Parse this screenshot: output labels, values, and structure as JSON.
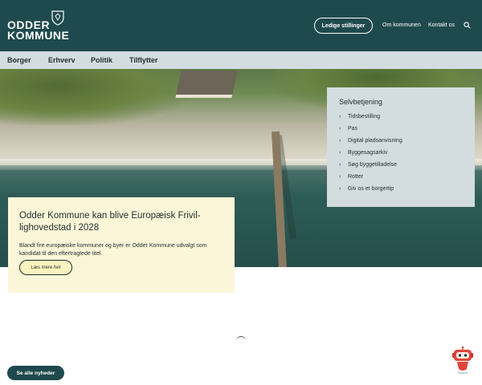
{
  "header": {
    "logo_line1": "ODDER",
    "logo_line2": "KOMMUNE",
    "jobs_button": "Ledige stillinger",
    "links": [
      "Om kommunen",
      "Kontakt os"
    ],
    "search_icon": "search-icon",
    "background_color": "#1f4a4d"
  },
  "nav": {
    "items": [
      "Borger",
      "Erhverv",
      "Politik",
      "Tilflytter"
    ],
    "background_color": "#d3dcdf"
  },
  "selfservice": {
    "title": "Selvbetjening",
    "items": [
      "Tidsbestilling",
      "Pas",
      "Digital pladsanvisning",
      "Byggesagsarkiv",
      "Søg byggetilladelse",
      "Rotter",
      "Giv os et borgertip"
    ]
  },
  "news_card": {
    "title": "Odder Kommune kan blive Europæisk Frivil­lighovedstad i 2028",
    "text": "Blandt fire europæiske kommuner og byer er Odder Kommune udvalgt som kandidat til den eftertragtede titel.",
    "button": "Læs mere her",
    "background_color": "#fbf6d8"
  },
  "bottom": {
    "all_news_button": "Se alle nyheder",
    "chat_icon": "robot-chat-icon"
  }
}
